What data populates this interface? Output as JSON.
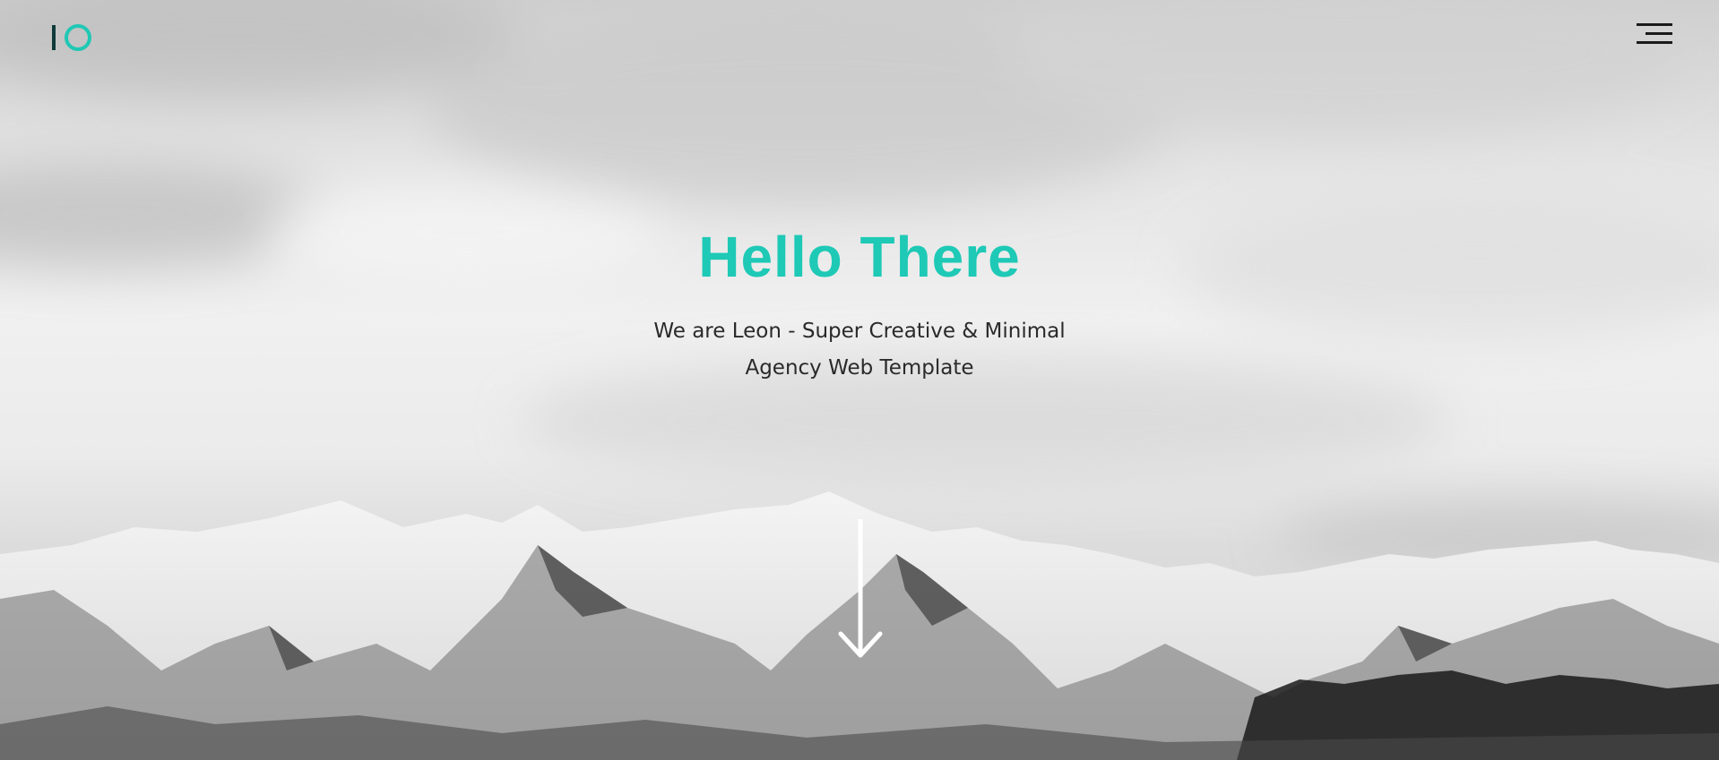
{
  "logo": {
    "name": "logo-io"
  },
  "menu": {
    "icon": "hamburger-menu-icon"
  },
  "hero": {
    "title": "Hello There",
    "subtitle_line1": "We are Leon - Super Creative & Minimal",
    "subtitle_line2": "Agency Web Template",
    "scroll_icon": "arrow-down-icon"
  },
  "colors": {
    "accent": "#1ec9b6",
    "logo_bar": "#0f3a3a",
    "text": "#2a2a2a"
  }
}
